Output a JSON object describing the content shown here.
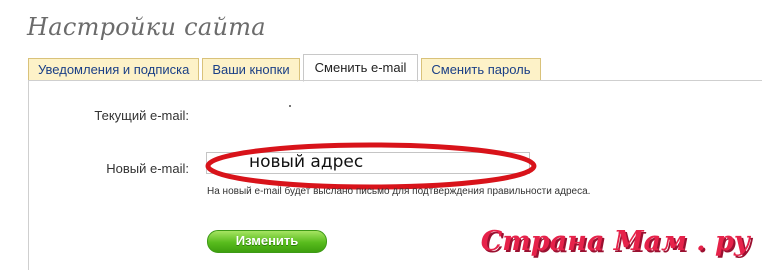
{
  "page": {
    "title": "Настройки сайта"
  },
  "tabs": [
    {
      "label": "Уведомления и подписка",
      "active": false
    },
    {
      "label": "Ваши кнопки",
      "active": false
    },
    {
      "label": "Сменить e-mail",
      "active": true
    },
    {
      "label": "Сменить пароль",
      "active": false
    }
  ],
  "form": {
    "current_email_label": "Текущий e-mail:",
    "new_email_label": "Новый e-mail:",
    "new_email_value": "новый адрес",
    "hint": "На новый e-mail будет выслано письмо для подтверждения правильности адреса.",
    "submit_label": "Изменить"
  },
  "annotation": {
    "color": "#d8131a"
  },
  "watermark": {
    "text": "Страна Мам . ру"
  },
  "colors": {
    "tab_bg": "#fdf2c8",
    "tab_text": "#1a3f86",
    "button_green": "#58bc1d",
    "watermark": "#e6224a"
  }
}
